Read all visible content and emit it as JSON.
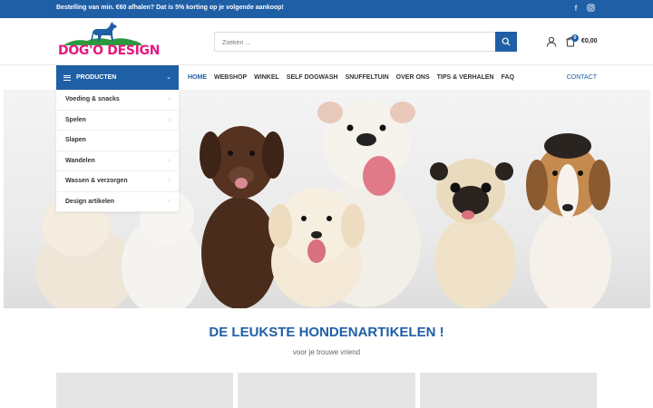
{
  "topbar": {
    "promo": "Bestelling van min. €60 afhalen? Dat is 5% korting op je volgende aankoop!",
    "social": [
      "facebook-icon",
      "instagram-icon"
    ]
  },
  "header": {
    "logo_text": "DOG'O DESIGN",
    "search": {
      "placeholder": "Zoeken ...",
      "value": ""
    },
    "cart": {
      "count": "0",
      "total": "€0,00"
    }
  },
  "nav": {
    "categories_label": "PRODUCTEN",
    "menu": [
      "HOME",
      "WEBSHOP",
      "WINKEL",
      "SELF DOGWASH",
      "SNUFFELTUIN",
      "OVER ONS",
      "TIPS & VERHALEN",
      "FAQ"
    ],
    "active": "HOME",
    "contact": "CONTACT"
  },
  "dropdown": {
    "items": [
      {
        "label": "Voeding & snacks",
        "has_sub": true
      },
      {
        "label": "Spelen",
        "has_sub": true
      },
      {
        "label": "Slapen",
        "has_sub": false
      },
      {
        "label": "Wandelen",
        "has_sub": true
      },
      {
        "label": "Wassen & verzorgen",
        "has_sub": true
      },
      {
        "label": "Design artikelen",
        "has_sub": true
      }
    ]
  },
  "section": {
    "title": "DE LEUKSTE HONDENARTIKELEN !",
    "subtitle": "voor je trouwe vriend"
  },
  "colors": {
    "brand_blue": "#1f5fa6",
    "logo_pink": "#e6197d"
  }
}
